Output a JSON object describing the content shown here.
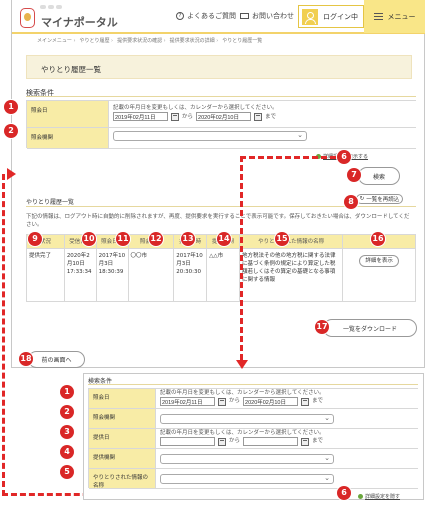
{
  "header": {
    "logo_text": "マイナポータル",
    "faq": "よくあるご質問",
    "contact": "お問い合わせ",
    "login": "ログイン中",
    "menu": "メニュー"
  },
  "breadcrumb": [
    "メインメニュー",
    "やりとり履歴",
    "提供要求状況の確認",
    "提供要求状況の詳細",
    "やりとり履歴一覧"
  ],
  "page_title": "やりとり履歴一覧",
  "search": {
    "title": "検索条件",
    "ref_date_label": "照会日",
    "date_help": "記載の年月日を変更もしくは、カレンダーから選択してください。",
    "date_from": "2019年02月11日",
    "date_to": "2020年02月10日",
    "from_text": "から",
    "to_text": "まで",
    "ref_org_label": "照会機関",
    "detail_link": "詳細設定を表示する",
    "search_button": "検索"
  },
  "history": {
    "title": "やりとり履歴一覧",
    "reload_button": "一覧を再読込",
    "note": "下記の情報は、ログアウト時に自動的に削除されますが、再度、提供要求を実行することで表示可能です。保存しておきたい場合は、ダウンロードしてください。",
    "columns": [
      "状況",
      "受信日時",
      "照会日時",
      "照会機関",
      "提供日時",
      "提供機関",
      "やりとりされた情報の名称",
      ""
    ],
    "row": {
      "status": "提供完了",
      "received": "2020年2月10日17:33:34",
      "ref_datetime": "2017年10月3日18:30:39",
      "ref_org": "〇〇市",
      "provided": "2017年10月3日20:30:30",
      "provider": "△△市",
      "info_name": "地方税法その他の地方税に関する法律に基づく条例の規定により算定した税額若しくはその算定の基礎となる事項に関する情報",
      "detail_button": "詳細を表示"
    },
    "download_button": "一覧をダウンロード",
    "back_button": "前の画面へ"
  },
  "detail": {
    "title": "検索条件",
    "rows": [
      "照会日",
      "照会機関",
      "提供日",
      "提供機関",
      "やりとりされた情報の名称"
    ],
    "date_help": "記載の年月日を変更もしくは、カレンダーから選択してください。",
    "date_from": "2019年02月11日",
    "date_to": "2020年02月10日",
    "from_text": "から",
    "to_text": "まで",
    "hide_link": "詳細設定を隠す"
  },
  "badges": [
    "1",
    "2",
    "6",
    "7",
    "8",
    "9",
    "10",
    "11",
    "12",
    "13",
    "14",
    "15",
    "16",
    "17",
    "18",
    "1",
    "2",
    "3",
    "4",
    "5",
    "6"
  ],
  "colors": {
    "accent": "#f8eca6",
    "brand_yellow": "#f1cf51",
    "badge_red": "#d92727"
  }
}
